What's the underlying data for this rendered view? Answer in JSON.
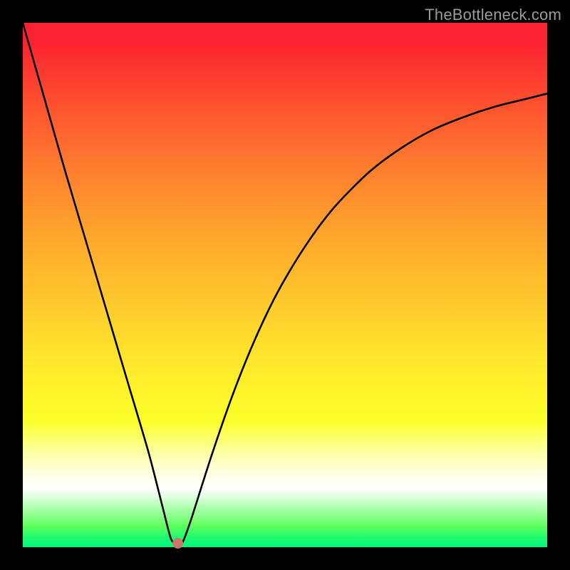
{
  "watermark": "TheBottleneck.com",
  "chart_data": {
    "type": "line",
    "title": "",
    "xlabel": "",
    "ylabel": "",
    "xlim": [
      0,
      1
    ],
    "ylim": [
      0,
      1
    ],
    "grid": false,
    "legend": false,
    "series": [
      {
        "name": "bottleneck-curve",
        "x": [
          0.0,
          0.04,
          0.08,
          0.12,
          0.16,
          0.2,
          0.24,
          0.267,
          0.283,
          0.296,
          0.304,
          0.32,
          0.36,
          0.4,
          0.44,
          0.48,
          0.52,
          0.56,
          0.6,
          0.66,
          0.72,
          0.78,
          0.84,
          0.9,
          0.96,
          1.0
        ],
        "y": [
          1.0,
          0.86,
          0.72,
          0.585,
          0.45,
          0.315,
          0.18,
          0.075,
          0.015,
          0.008,
          0.008,
          0.05,
          0.175,
          0.29,
          0.39,
          0.475,
          0.545,
          0.605,
          0.655,
          0.715,
          0.76,
          0.795,
          0.82,
          0.84,
          0.855,
          0.865
        ]
      }
    ],
    "marker": {
      "x": 0.296,
      "y": 0.008,
      "color": "#cb7866"
    },
    "gradient_stops": [
      {
        "pos": 0.0,
        "color": "#fb2331"
      },
      {
        "pos": 0.3,
        "color": "#ff8a2e"
      },
      {
        "pos": 0.6,
        "color": "#ffe02b"
      },
      {
        "pos": 0.85,
        "color": "#fdffa5"
      },
      {
        "pos": 0.9,
        "color": "#e9ffe9"
      },
      {
        "pos": 1.0,
        "color": "#00f57d"
      }
    ]
  }
}
